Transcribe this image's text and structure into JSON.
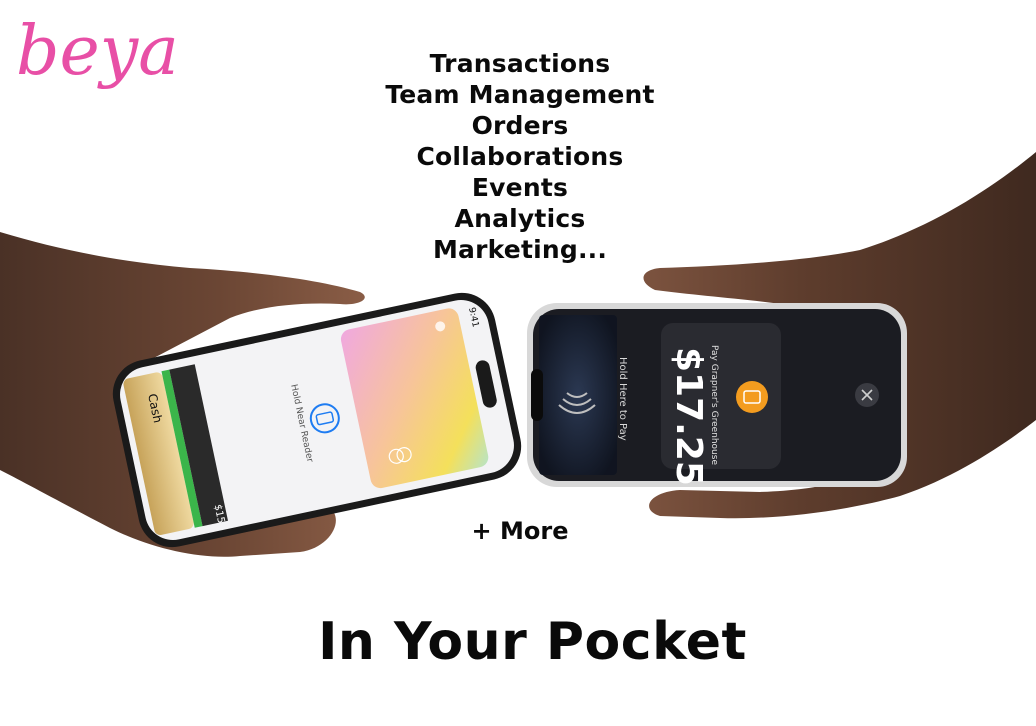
{
  "brand": {
    "logo_text": "beya",
    "logo_color": "#e84fa6"
  },
  "features": [
    "Transactions",
    "Team Management",
    "Orders",
    "Collaborations",
    "Events",
    "Analytics",
    "Marketing..."
  ],
  "more_label": "+ More",
  "headline": "In Your Pocket",
  "left_phone": {
    "status_time": "9:41",
    "cash_label": "Cash",
    "cash_amount": "$15",
    "hold_text": "Hold Near Reader"
  },
  "right_phone": {
    "hold_text": "Hold Here to Pay",
    "pay_label": "Pay Grapner's Greenhouse",
    "amount": "$17.25"
  },
  "icons": [
    "apple-icon",
    "contactless-icon",
    "phone-icon",
    "shop-basket-icon",
    "close-icon",
    "mastercard-icon"
  ]
}
